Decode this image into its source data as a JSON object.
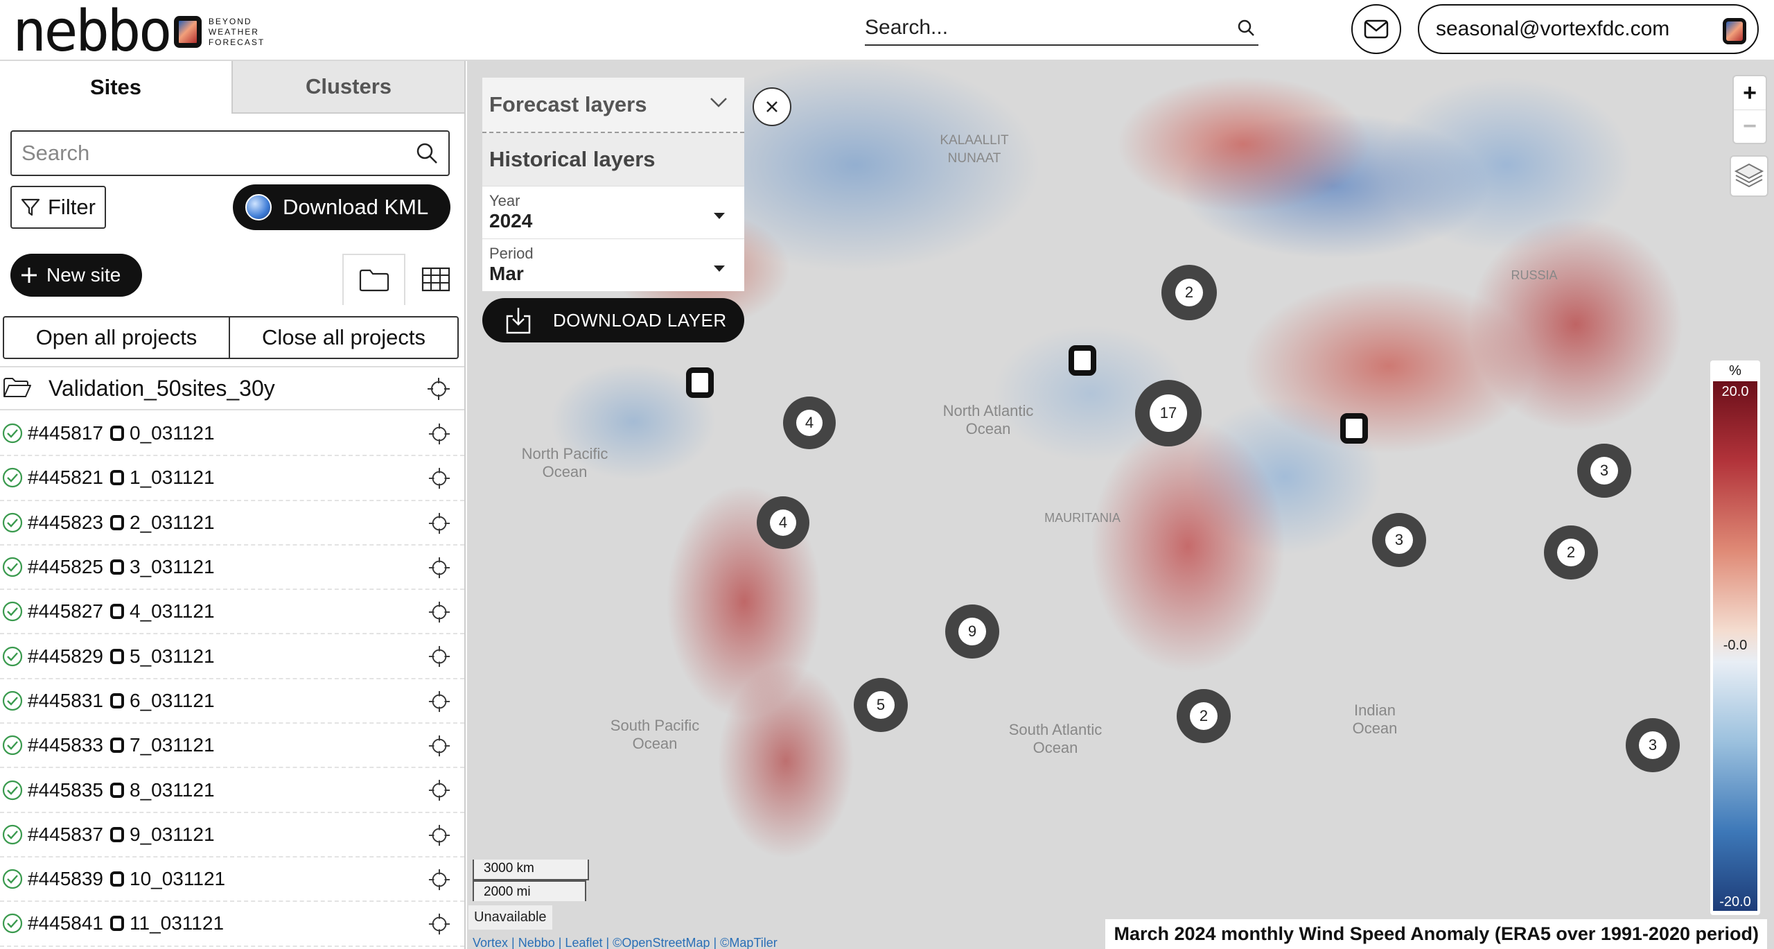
{
  "brand": {
    "logo_text": "nebbo",
    "tagline": [
      "BEYOND",
      "WEATHER",
      "FORECAST"
    ]
  },
  "header": {
    "search_placeholder": "Search...",
    "user_email": "seasonal@vortexfdc.com"
  },
  "sidebar": {
    "tabs": [
      {
        "label": "Sites",
        "active": true
      },
      {
        "label": "Clusters",
        "active": false
      }
    ],
    "search_placeholder": "Search",
    "filter_label": "Filter",
    "download_kml_label": "Download KML",
    "new_site_label": "New site",
    "open_all_label": "Open all projects",
    "close_all_label": "Close all projects",
    "project_name": "Validation_50sites_30y",
    "sites": [
      {
        "id": "#445817",
        "name": "0_031121"
      },
      {
        "id": "#445821",
        "name": "1_031121"
      },
      {
        "id": "#445823",
        "name": "2_031121"
      },
      {
        "id": "#445825",
        "name": "3_031121"
      },
      {
        "id": "#445827",
        "name": "4_031121"
      },
      {
        "id": "#445829",
        "name": "5_031121"
      },
      {
        "id": "#445831",
        "name": "6_031121"
      },
      {
        "id": "#445833",
        "name": "7_031121"
      },
      {
        "id": "#445835",
        "name": "8_031121"
      },
      {
        "id": "#445837",
        "name": "9_031121"
      },
      {
        "id": "#445839",
        "name": "10_031121"
      },
      {
        "id": "#445841",
        "name": "11_031121"
      }
    ]
  },
  "layer_panel": {
    "forecast_label": "Forecast layers",
    "historical_label": "Historical layers",
    "year_label": "Year",
    "year_value": "2024",
    "period_label": "Period",
    "period_value": "Mar",
    "download_label": "DOWNLOAD LAYER"
  },
  "map": {
    "labels": [
      {
        "text": "KALAALLIT NUNAAT"
      },
      {
        "text": "North Atlantic Ocean"
      },
      {
        "text": "North Pacific Ocean"
      },
      {
        "text": "South Pacific Ocean"
      },
      {
        "text": "South Atlantic Ocean"
      },
      {
        "text": "Indian Ocean"
      },
      {
        "text": "RUSSIA"
      },
      {
        "text": "MAURITANIA"
      }
    ],
    "clusters": [
      {
        "count": "2"
      },
      {
        "count": "17"
      },
      {
        "count": "4"
      },
      {
        "count": "4"
      },
      {
        "count": "9"
      },
      {
        "count": "5"
      },
      {
        "count": "2"
      },
      {
        "count": "3"
      },
      {
        "count": "2"
      },
      {
        "count": "3"
      },
      {
        "count": "3"
      }
    ],
    "zoom_in": "+",
    "zoom_out": "−",
    "legend": {
      "unit": "%",
      "max": "20.0",
      "mid": "-0.0",
      "min": "-20.0"
    },
    "scale_km": "3000 km",
    "scale_mi": "2000 mi",
    "unavailable": "Unavailable",
    "attribution": "Vortex | Nebbo | Leaflet | ©OpenStreetMap | ©MapTiler",
    "caption": "March 2024 monthly Wind Speed Anomaly (ERA5 over 1991-2020 period)",
    "colors": {
      "positive": "#b2333a",
      "negative": "#3d78b8"
    }
  }
}
